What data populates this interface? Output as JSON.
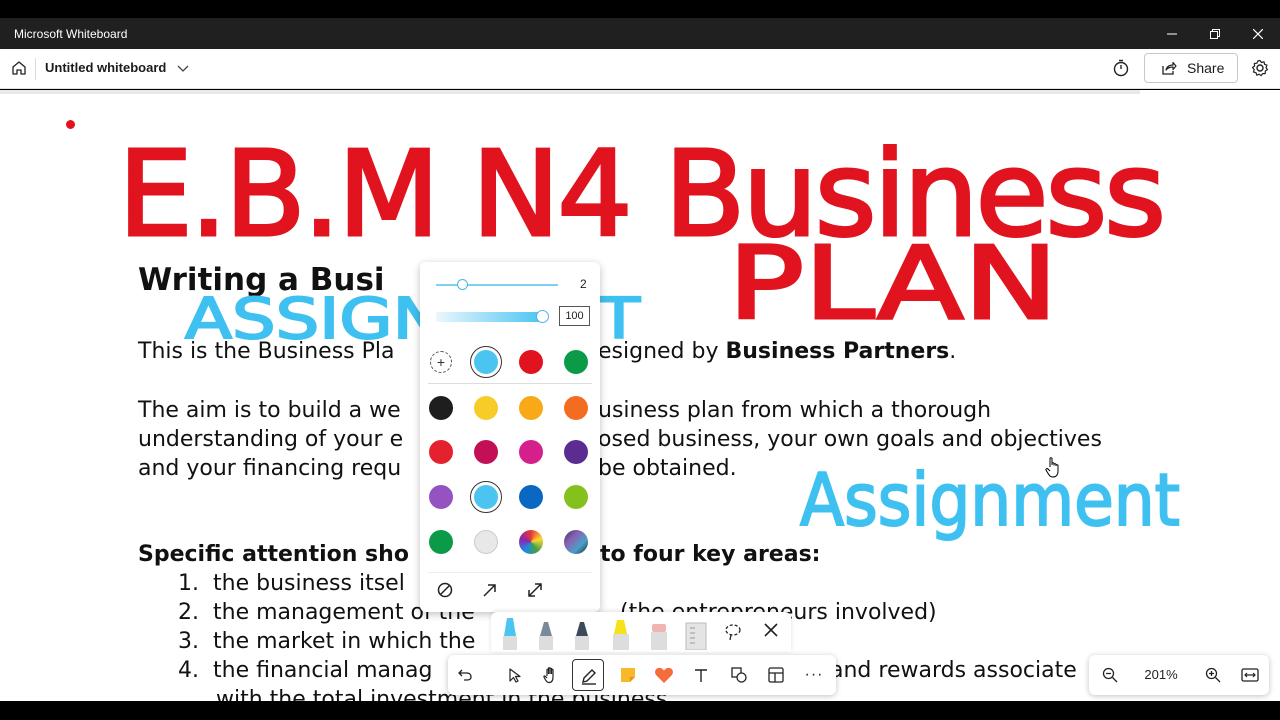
{
  "app": {
    "title": "Microsoft Whiteboard"
  },
  "toolbar": {
    "board_title": "Untitled whiteboard",
    "share_label": "Share"
  },
  "document": {
    "heading": "Writing a Busi",
    "intro_start": "This is the Business Pla",
    "intro_mid": "esigned by ",
    "intro_bold": "Business Partners",
    "intro_end": ".",
    "aim_line1a": "The aim is to build a we",
    "aim_line1b": "usiness plan from which a thorough",
    "aim_line2a": "understanding of your e",
    "aim_line2b": "osed business, your own goals and objectives",
    "aim_line3a": "and your financing requ",
    "aim_line3b": "be obtained.",
    "attention_a": "Specific attention sho",
    "attention_b": "to four key areas:",
    "list": [
      {
        "num": "1.",
        "text": "the business itsel"
      },
      {
        "num": "2.",
        "text": "the management of the",
        "tail": "(the entrepreneurs involved)"
      },
      {
        "num": "3.",
        "text": "the market in which the"
      },
      {
        "num": "4.",
        "text": "the financial manag",
        "tail": "and rewards associate"
      },
      {
        "num": "",
        "text": "with the total investment in the business"
      }
    ]
  },
  "ink": {
    "title_line1": "E.B.M N4 Business",
    "title_line2": "PLAN",
    "assignment_1": "ASSIGNMENT",
    "assignment_2": "Assignment",
    "red": "#e0131f",
    "blue": "#3ec1f0"
  },
  "pen_settings": {
    "thickness_value": "2",
    "opacity_value": "100"
  },
  "palette": {
    "row1": [
      "#4cc4f2",
      "#e0131f",
      "#0a9a48"
    ],
    "grid": [
      [
        "#1e1e1e",
        "#f7cc28",
        "#f7a918",
        "#f26c21"
      ],
      [
        "#e3222d",
        "#c20f56",
        "#d51f8c",
        "#5c2d91"
      ],
      [
        "#9553c2",
        "#4cc4f2",
        "#0a67c2",
        "#85c11c"
      ],
      [
        "#0a9a48",
        "#e8e8e8",
        "rainbow",
        "galaxy"
      ]
    ]
  },
  "zoom": {
    "level": "201%"
  }
}
